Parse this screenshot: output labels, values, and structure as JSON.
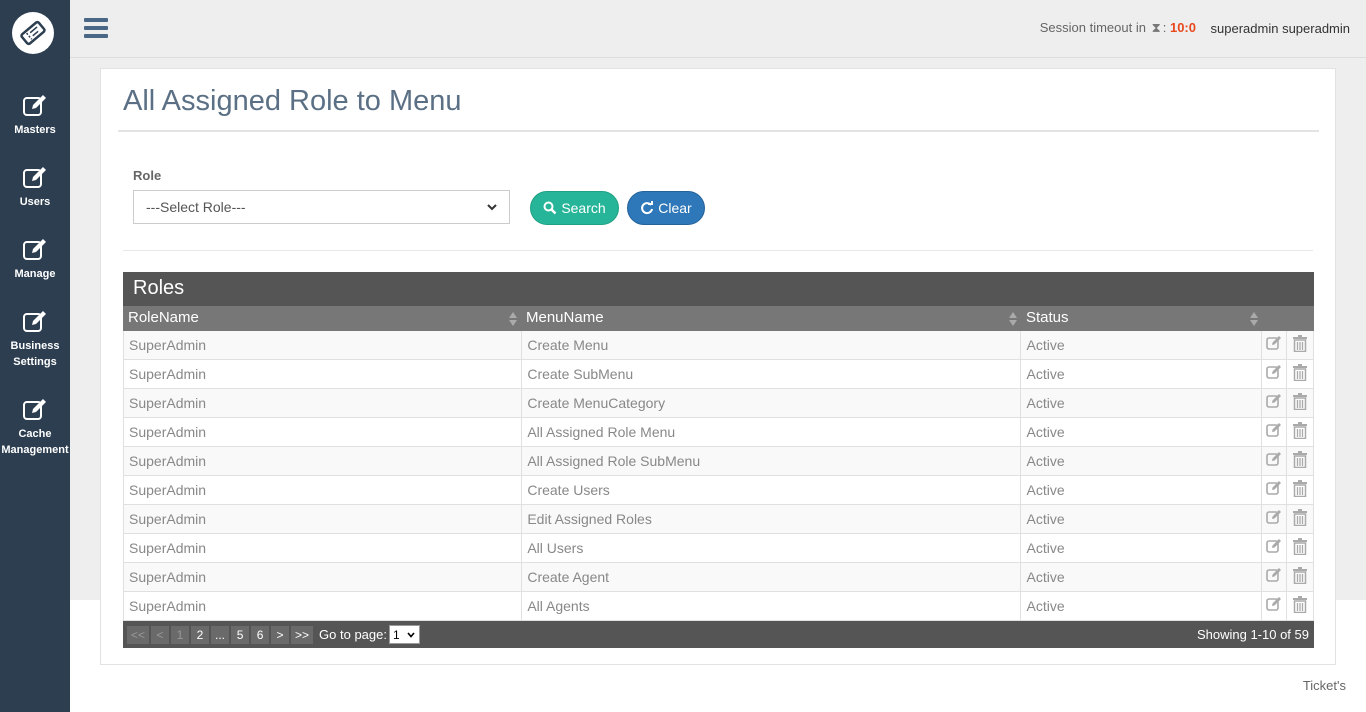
{
  "sidebar": {
    "logo_icon": "ticket-logo-icon",
    "items": [
      {
        "label_line1": "Masters",
        "label_line2": "",
        "icon": "edit-icon"
      },
      {
        "label_line1": "Users",
        "label_line2": "",
        "icon": "edit-icon"
      },
      {
        "label_line1": "Manage",
        "label_line2": "",
        "icon": "edit-icon"
      },
      {
        "label_line1": "Business",
        "label_line2": "Settings",
        "icon": "edit-icon"
      },
      {
        "label_line1": "Cache",
        "label_line2": "Management",
        "icon": "edit-icon"
      }
    ]
  },
  "topbar": {
    "menu_icon": "hamburger-icon",
    "session_label": "Session timeout in",
    "session_separator": ":",
    "session_timer": "10:0",
    "username": "superadmin superadmin"
  },
  "page": {
    "title": "All Assigned Role to Menu"
  },
  "filter": {
    "role_label": "Role",
    "role_select_value": "---Select Role---",
    "search_label": "Search",
    "clear_label": "Clear"
  },
  "grid": {
    "caption": "Roles",
    "columns": [
      "RoleName",
      "MenuName",
      "Status"
    ],
    "rows": [
      {
        "role": "SuperAdmin",
        "menu": "Create Menu",
        "status": "Active"
      },
      {
        "role": "SuperAdmin",
        "menu": "Create SubMenu",
        "status": "Active"
      },
      {
        "role": "SuperAdmin",
        "menu": "Create MenuCategory",
        "status": "Active"
      },
      {
        "role": "SuperAdmin",
        "menu": "All Assigned Role Menu",
        "status": "Active"
      },
      {
        "role": "SuperAdmin",
        "menu": "All Assigned Role SubMenu",
        "status": "Active"
      },
      {
        "role": "SuperAdmin",
        "menu": "Create Users",
        "status": "Active"
      },
      {
        "role": "SuperAdmin",
        "menu": "Edit Assigned Roles",
        "status": "Active"
      },
      {
        "role": "SuperAdmin",
        "menu": "All Users",
        "status": "Active"
      },
      {
        "role": "SuperAdmin",
        "menu": "Create Agent",
        "status": "Active"
      },
      {
        "role": "SuperAdmin",
        "menu": "All Agents",
        "status": "Active"
      }
    ]
  },
  "pager": {
    "first": "<<",
    "prev": "<",
    "pages": [
      "1",
      "2",
      "...",
      "5",
      "6"
    ],
    "next": ">",
    "last": ">>",
    "goto_label": "Go to page:",
    "goto_value": "1",
    "showing": "Showing 1-10 of 59"
  },
  "footer": {
    "link": "Ticket's"
  },
  "colors": {
    "sidebar": "#2c3e50",
    "search_button": "#26b598",
    "clear_button": "#2e77b8",
    "timer": "#e8491d",
    "grid_header": "#555555"
  }
}
